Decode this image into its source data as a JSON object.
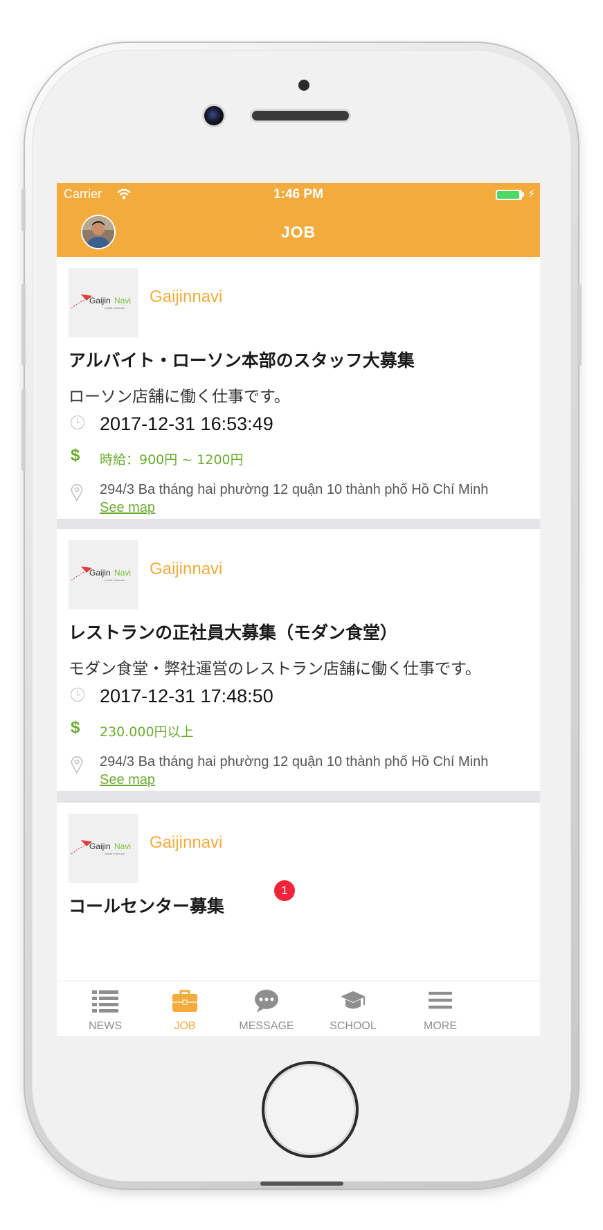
{
  "status_bar": {
    "carrier": "Carrier",
    "time": "1:46 PM"
  },
  "nav": {
    "title": "JOB"
  },
  "jobs": [
    {
      "company": "Gaijinnavi",
      "title": "アルバイト・ローソン本部のスタッフ大募集",
      "description": "ローソン店舗に働く仕事です。",
      "date": "2017-12-31 16:53:49",
      "salary": "時給：900円 ~ 1200円",
      "address": "294/3 Ba tháng hai phường 12 quận 10 thành phố Hồ Chí Minh",
      "map_link": "See map"
    },
    {
      "company": "Gaijinnavi",
      "title": "レストランの正社員大募集（モダン食堂）",
      "description": "モダン食堂・弊社運営のレストラン店舗に働く仕事です。",
      "date": "2017-12-31 17:48:50",
      "salary": "230.000円以上",
      "address": "294/3 Ba tháng hai phường 12 quận 10 thành phố Hồ Chí Minh",
      "map_link": "See map"
    },
    {
      "company": "Gaijinnavi",
      "title": "コールセンター募集"
    }
  ],
  "logo": {
    "text_main": "Gaijin",
    "text_accent": "Navi",
    "tagline": "create tomorrow"
  },
  "tabs": [
    {
      "label": "NEWS",
      "icon": "list-icon"
    },
    {
      "label": "JOB",
      "icon": "briefcase-icon"
    },
    {
      "label": "MESSAGE",
      "icon": "chat-bubble-icon"
    },
    {
      "label": "SCHOOL",
      "icon": "graduation-cap-icon"
    },
    {
      "label": "MORE",
      "icon": "hamburger-icon"
    }
  ],
  "message_badge": "1",
  "colors": {
    "accent": "#f2ab3c",
    "green": "#6aac2f",
    "badge": "#f0243a",
    "battery": "#4cd964"
  }
}
